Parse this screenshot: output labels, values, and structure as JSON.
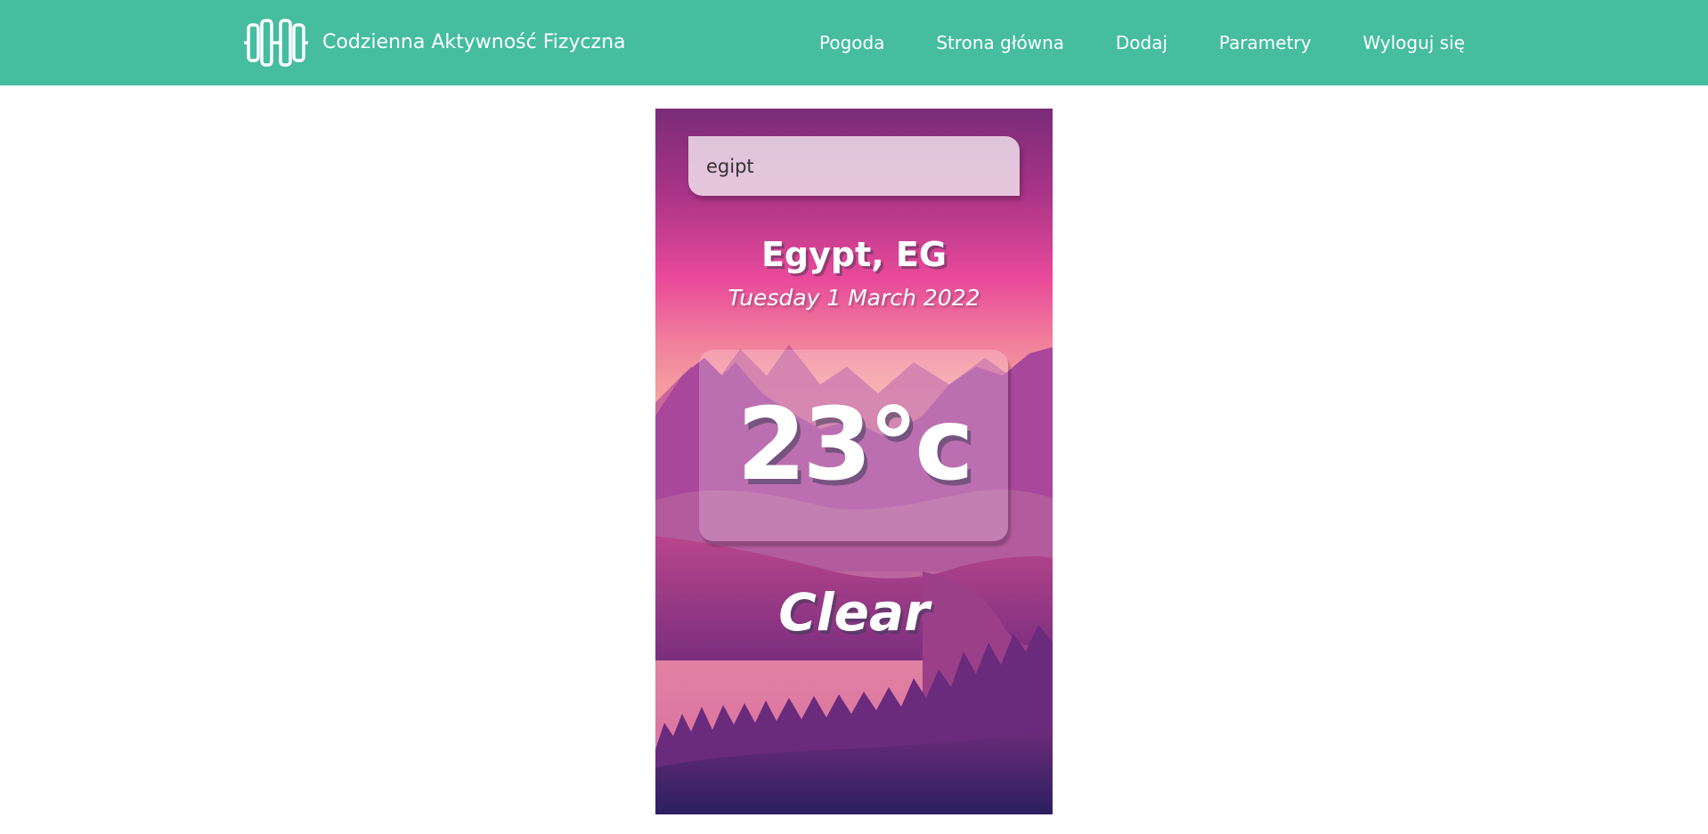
{
  "header": {
    "brand_title": "Codzienna Aktywność Fizyczna",
    "logo_icon": "dumbbell-icon",
    "background_color": "#45bd9e",
    "nav": [
      {
        "label": "Pogoda"
      },
      {
        "label": "Strona główna"
      },
      {
        "label": "Dodaj"
      },
      {
        "label": "Parametry"
      },
      {
        "label": "Wyloguj się"
      }
    ]
  },
  "weather": {
    "search_value": "egipt",
    "location": "Egypt, EG",
    "date": "Tuesday 1 March 2022",
    "temperature": "23°c",
    "condition": "Clear",
    "background_colors": {
      "sky_top": "#7a2c77",
      "sky_mid": "#e9499a",
      "horizon": "#f6a7a0",
      "ground_bottom": "#2a2060"
    }
  }
}
